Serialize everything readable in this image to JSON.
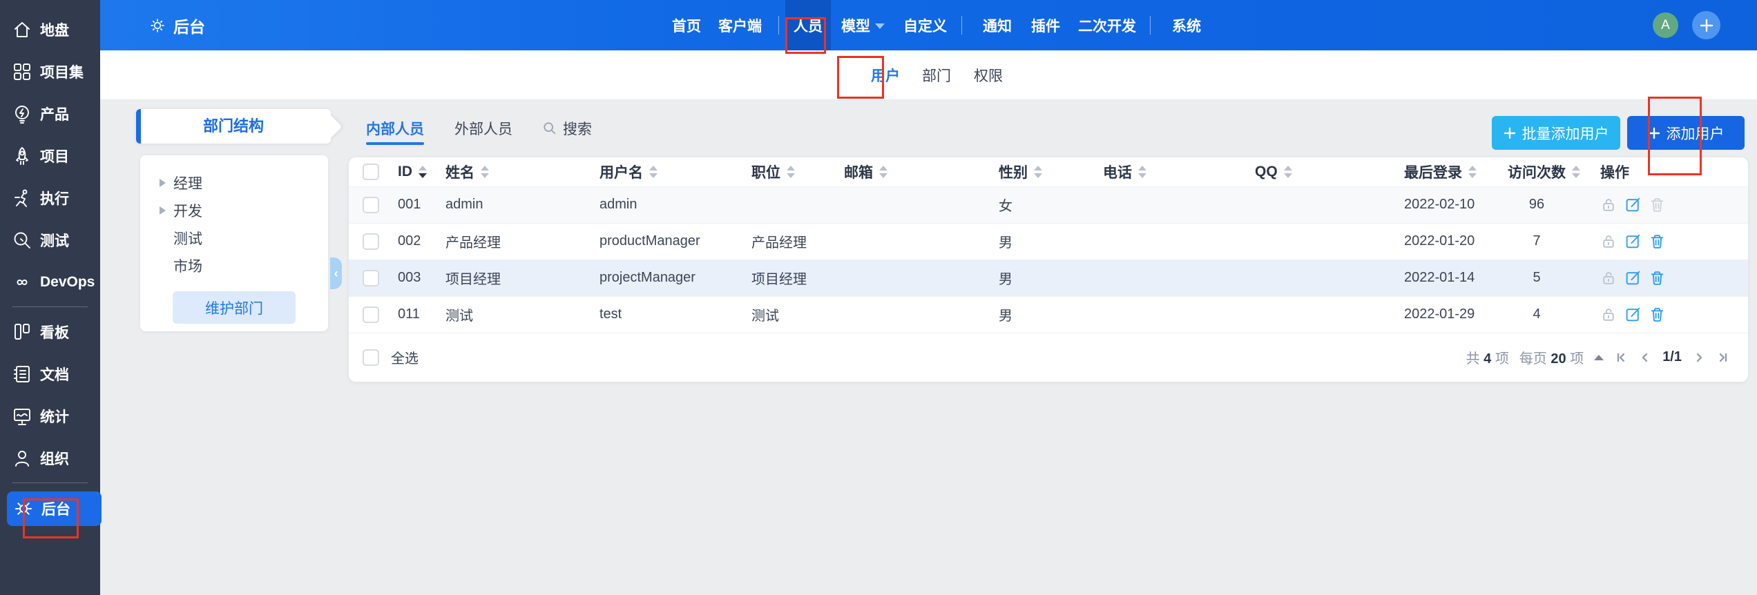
{
  "colors": {
    "topbar_blue": "#1169E5",
    "active_menu_blue": "#0D55C4",
    "sidebar_bg": "#323B4D",
    "sidebar_active_blue": "#1B6BE8",
    "accent_blue": "#2376E8",
    "batch_button_blue": "#29B5F2",
    "add_button_blue": "#1765E3",
    "annotation_red": "#EC3323",
    "row_highlight_blue": "#E9F0FA",
    "avatar_green": "#62A883"
  },
  "sidebar": {
    "items": [
      {
        "label": "地盘",
        "icon": "home-icon"
      },
      {
        "label": "项目集",
        "icon": "project-set-icon"
      },
      {
        "label": "产品",
        "icon": "product-bulb-icon"
      },
      {
        "label": "项目",
        "icon": "rocket-icon"
      },
      {
        "label": "执行",
        "icon": "runner-icon"
      },
      {
        "label": "测试",
        "icon": "magnifier-icon"
      },
      {
        "label": "DevOps",
        "icon": "infinity-icon"
      },
      {
        "label": "看板",
        "icon": "kanban-icon"
      },
      {
        "label": "文档",
        "icon": "document-icon"
      },
      {
        "label": "统计",
        "icon": "stats-icon"
      },
      {
        "label": "组织",
        "icon": "org-person-icon"
      },
      {
        "label": "后台",
        "icon": "gear-icon",
        "active": true
      }
    ]
  },
  "topbar": {
    "brand": "后台",
    "brand_icon": "gear-icon",
    "menu": [
      {
        "label": "首页"
      },
      {
        "label": "客户端"
      },
      {
        "label": "人员",
        "active": true
      },
      {
        "label": "模型",
        "dropdown": true
      },
      {
        "label": "自定义"
      },
      {
        "label": "通知"
      },
      {
        "label": "插件"
      },
      {
        "label": "二次开发"
      },
      {
        "label": "系统"
      }
    ],
    "avatar": "A",
    "add_icon": "plus-icon"
  },
  "subnav": {
    "tabs": [
      {
        "label": "用户",
        "active": true
      },
      {
        "label": "部门"
      },
      {
        "label": "权限"
      }
    ]
  },
  "dept_panel": {
    "title": "部门结构",
    "tree": [
      {
        "label": "经理",
        "expandable": true
      },
      {
        "label": "开发",
        "expandable": true
      },
      {
        "label": "测试",
        "expandable": false
      },
      {
        "label": "市场",
        "expandable": false
      }
    ],
    "maintain_button": "维护部门",
    "collapse_icon": "chevron-left-icon"
  },
  "toolbar": {
    "tabs": [
      {
        "label": "内部人员",
        "active": true
      },
      {
        "label": "外部人员"
      },
      {
        "label": "搜索",
        "icon": "search-icon"
      }
    ],
    "batch_add_button": "批量添加用户",
    "add_button": "添加用户"
  },
  "table": {
    "columns": [
      "ID",
      "姓名",
      "用户名",
      "职位",
      "邮箱",
      "性别",
      "电话",
      "QQ",
      "最后登录",
      "访问次数",
      "操作"
    ],
    "sort_column": "ID",
    "sort_direction": "desc",
    "action_icons": [
      "unlock-icon",
      "edit-icon",
      "delete-icon"
    ],
    "rows": [
      {
        "id": "001",
        "name": "admin",
        "account": "admin",
        "title": "",
        "email": "",
        "gender": "女",
        "phone": "",
        "qq": "",
        "last_login": "2022-02-10",
        "visits": "96",
        "delete_disabled": true
      },
      {
        "id": "002",
        "name": "产品经理",
        "account": "productManager",
        "title": "产品经理",
        "email": "",
        "gender": "男",
        "phone": "",
        "qq": "",
        "last_login": "2022-01-20",
        "visits": "7",
        "delete_disabled": false
      },
      {
        "id": "003",
        "name": "项目经理",
        "account": "projectManager",
        "title": "项目经理",
        "email": "",
        "gender": "男",
        "phone": "",
        "qq": "",
        "last_login": "2022-01-14",
        "visits": "5",
        "delete_disabled": false,
        "highlighted": true
      },
      {
        "id": "011",
        "name": "测试",
        "account": "test",
        "title": "测试",
        "email": "",
        "gender": "男",
        "phone": "",
        "qq": "",
        "last_login": "2022-01-29",
        "visits": "4",
        "delete_disabled": false
      }
    ],
    "select_all_label": "全选"
  },
  "pagination": {
    "total_prefix": "共",
    "total_count": "4",
    "total_suffix": "项",
    "per_page_prefix": "每页",
    "per_page_count": "20",
    "per_page_suffix": "项",
    "page_indicator": "1/1"
  }
}
